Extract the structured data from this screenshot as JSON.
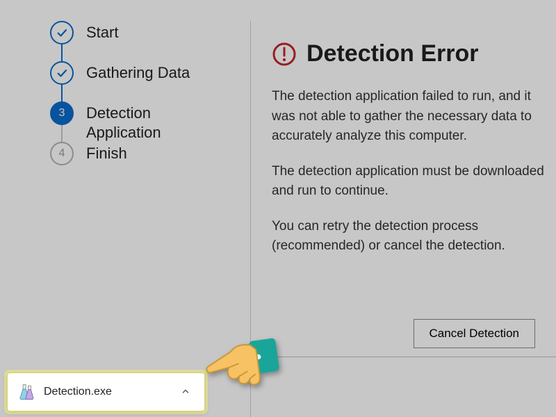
{
  "sidebar": {
    "steps": [
      {
        "label": "Start",
        "state": "done"
      },
      {
        "label": "Gathering Data",
        "state": "done"
      },
      {
        "label": "Detection Application",
        "state": "current",
        "number": "3"
      },
      {
        "label": "Finish",
        "state": "pending",
        "number": "4"
      }
    ]
  },
  "content": {
    "title": "Detection Error",
    "para1": "The detection application failed to run, and it was not able to gather the necessary data to accurately analyze this computer.",
    "para2": "The detection application must be downloaded and run to continue.",
    "para3": "You can retry the detection process (recommended) or cancel the detection.",
    "cancel_label": "Cancel Detection"
  },
  "download": {
    "filename": "Detection.exe"
  },
  "colors": {
    "accent": "#0b6bcb",
    "error": "#c1272d",
    "hand_skin": "#f6c263",
    "hand_cuff": "#1aa59a"
  }
}
